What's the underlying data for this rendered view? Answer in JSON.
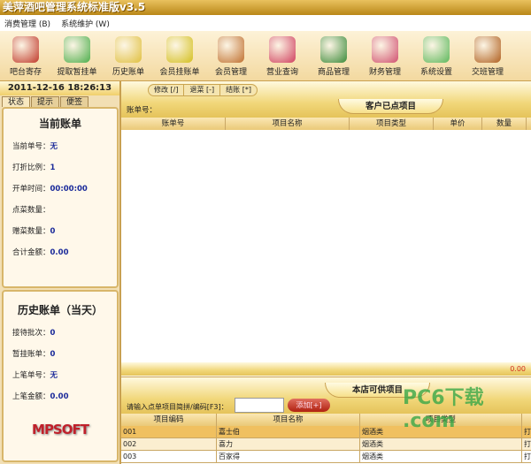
{
  "title": "美萍酒吧管理系统标准版v3.5",
  "menu": [
    "消费管理 (B)",
    "系统维护 (W)"
  ],
  "toolbar": [
    {
      "label": "吧台寄存",
      "icon": "storage-box-icon",
      "color": "#c0392b"
    },
    {
      "label": "提取暂挂单",
      "icon": "add-cross-icon",
      "color": "#4cae4c"
    },
    {
      "label": "历史账单",
      "icon": "clock-icon",
      "color": "#e0c040"
    },
    {
      "label": "会员挂账单",
      "icon": "dollar-arrow-icon",
      "color": "#d4c020"
    },
    {
      "label": "会员管理",
      "icon": "members-icon",
      "color": "#c07030"
    },
    {
      "label": "营业查询",
      "icon": "query-icon",
      "color": "#d04060"
    },
    {
      "label": "商品管理",
      "icon": "beer-bottle-icon",
      "color": "#3a8a3a"
    },
    {
      "label": "财务管理",
      "icon": "calculator-icon",
      "color": "#d05070"
    },
    {
      "label": "系统设置",
      "icon": "gears-icon",
      "color": "#5cb85c"
    },
    {
      "label": "交班管理",
      "icon": "exit-door-icon",
      "color": "#b06020"
    }
  ],
  "left": {
    "datetime": "2011-12-16  18:26:13",
    "tabs": [
      "状态",
      "提示",
      "便签"
    ],
    "current": {
      "title": "当前账单",
      "rows": [
        {
          "label": "当前单号：",
          "value": "无"
        },
        {
          "label": "打折比例：",
          "value": "1"
        },
        {
          "label": "开单时间：",
          "value": "00:00:00"
        },
        {
          "label": "点菜数量：",
          "value": ""
        },
        {
          "label": "赠菜数量：",
          "value": "0"
        },
        {
          "label": "合计金额：",
          "value": "0.00"
        }
      ]
    },
    "history": {
      "title": "历史账单（当天）",
      "rows": [
        {
          "label": "接待批次：",
          "value": "0"
        },
        {
          "label": "暂挂账单：",
          "value": "0"
        },
        {
          "label": "上笔单号：",
          "value": "无"
        },
        {
          "label": "上笔金额：",
          "value": "0.00"
        }
      ]
    },
    "logo": "MPSOFT"
  },
  "order": {
    "actions": [
      "修改 [/]",
      "退菜 [-]",
      "结账 [*]"
    ],
    "bill_label": "账单号：",
    "section_title": "客户已点项目",
    "columns": [
      "账单号",
      "项目名称",
      "项目类型",
      "单价",
      "数量"
    ],
    "total": "0.00"
  },
  "catalog": {
    "section_title": "本店可供项目",
    "search_label": "请输入点单项目简拼/编码[F3]：",
    "search_value": "",
    "add_button": "添加[+]",
    "columns": [
      "项目编码",
      "项目名称",
      "项目类型"
    ],
    "rows": [
      {
        "code": "001",
        "name": "嘉士伯",
        "type": "烟酒类",
        "extra": "打"
      },
      {
        "code": "002",
        "name": "喜力",
        "type": "烟酒类",
        "extra": "打"
      },
      {
        "code": "003",
        "name": "百家得",
        "type": "烟酒类",
        "extra": "打"
      }
    ]
  },
  "watermark": "PC6下载 .com"
}
